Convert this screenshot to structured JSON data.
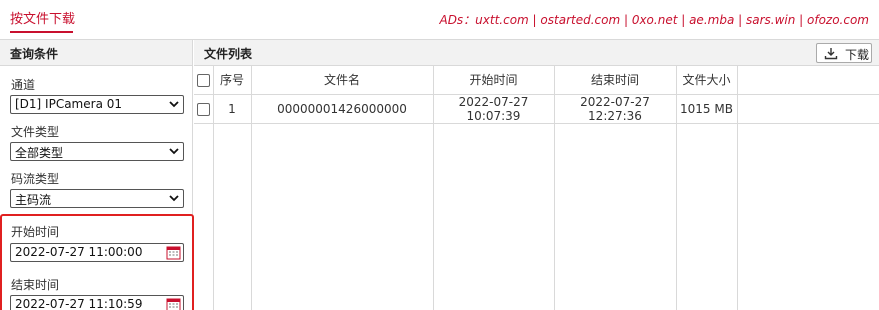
{
  "top": {
    "tab_label": "按文件下载",
    "ads_text": "ADs：uxtt.com | ostarted.com | 0xo.net | ae.mba | sars.win | ofozo.com"
  },
  "left": {
    "title": "查询条件",
    "channel_label": "通道",
    "channel_value": "[D1] IPCamera 01",
    "file_type_label": "文件类型",
    "file_type_value": "全部类型",
    "stream_type_label": "码流类型",
    "stream_type_value": "主码流",
    "start_label": "开始时间",
    "start_value": "2022-07-27 11:00:00",
    "end_label": "结束时间",
    "end_value": "2022-07-27 11:10:59"
  },
  "right": {
    "title": "文件列表",
    "download_label": "下载",
    "columns": [
      "序号",
      "文件名",
      "开始时间",
      "结束时间",
      "文件大小"
    ],
    "rows": [
      [
        "1",
        "00000001426000000",
        "2022-07-27 10:07:39",
        "2022-07-27 12:27:36",
        "1015 MB"
      ]
    ]
  },
  "colors": {
    "accent": "#c8102e",
    "highlight_box": "#e02020"
  }
}
